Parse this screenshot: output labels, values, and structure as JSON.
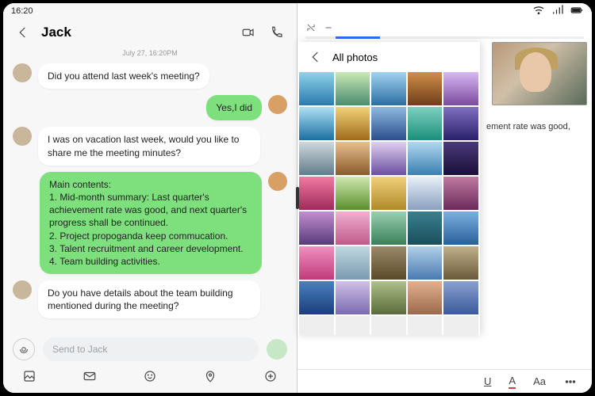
{
  "status": {
    "time": "16:20"
  },
  "chat": {
    "contact_name": "Jack",
    "date_separator": "July 27, 16:20PM",
    "messages": [
      {
        "dir": "in",
        "text": "Did you attend last week's meeting?"
      },
      {
        "dir": "out",
        "text": "Yes,I did"
      },
      {
        "dir": "in",
        "text": "I was on vacation last week, would you like to share me the meeting minutes?"
      },
      {
        "dir": "out",
        "text": "Main contents:\n1. Mid-month summary: Last quarter's achievement rate was good, and next quarter's progress shall be continued.\n2. Project propoganda keep commucation.\n3. Talent recruitment and career development.\n4. Team building activities."
      },
      {
        "dir": "in",
        "text": "Do you have details about the team building mentioned during the meeting?"
      }
    ],
    "composer_placeholder": "Send to Jack"
  },
  "gallery": {
    "title": "All photos"
  },
  "doc": {
    "snippet": "ement rate was good,"
  },
  "format": {
    "underline": "U",
    "color": "A",
    "size": "Aa"
  }
}
